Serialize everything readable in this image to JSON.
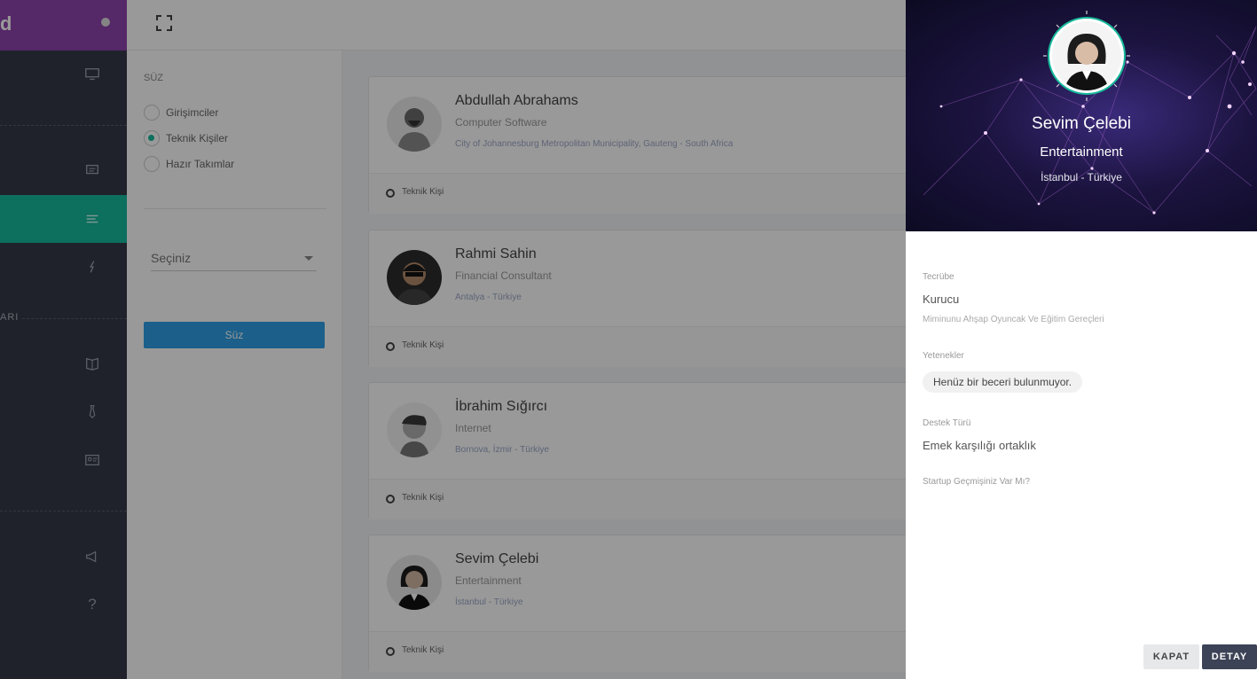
{
  "brand": {
    "logo_text": "d"
  },
  "sidebar": {
    "section_label": "ARI",
    "icons": [
      "monitor-icon",
      "chat-icon",
      "list-icon",
      "rocket-icon",
      "book-icon",
      "tie-icon",
      "id-card-icon",
      "megaphone-icon",
      "help-icon"
    ],
    "help_glyph": "?"
  },
  "filter": {
    "title": "SÜZ",
    "options": [
      {
        "label": "Girişimciler",
        "checked": false
      },
      {
        "label": "Teknik Kişiler",
        "checked": true
      },
      {
        "label": "Hazır Takımlar",
        "checked": false
      }
    ],
    "select_value": "Seçiniz",
    "button_label": "Süz"
  },
  "cards": [
    {
      "name": "Abdullah Abrahams",
      "title": "Computer Software",
      "location": "City of Johannesburg Metropolitan Municipality, Gauteng - South Africa",
      "tag": "Teknik Kişi"
    },
    {
      "name": "Rahmi Sahin",
      "title": "Financial Consultant",
      "location": "Antalya - Türkiye",
      "tag": "Teknik Kişi"
    },
    {
      "name": "İbrahim Sığırcı",
      "title": "Internet",
      "location": "Bornova, İzmir - Türkiye",
      "tag": "Teknik Kişi"
    },
    {
      "name": "Sevim Çelebi",
      "title": "Entertainment",
      "location": "İstanbul - Türkiye",
      "tag": "Teknik Kişi"
    }
  ],
  "profile": {
    "name": "Sevim Çelebi",
    "sector": "Entertainment",
    "location": "İstanbul - Türkiye",
    "experience_label": "Tecrübe",
    "experience_value": "Kurucu",
    "experience_company": "Miminunu Ahşap Oyuncak Ve Eğitim Gereçleri",
    "skills_label": "Yetenekler",
    "skills_empty": "Henüz bir beceri bulunmuyor.",
    "support_label": "Destek Türü",
    "support_value": "Emek karşılığı ortaklık",
    "startup_label": "Startup Geçmişiniz Var Mı?",
    "close_label": "KAPAT",
    "detail_label": "DETAY"
  },
  "colors": {
    "accent_green": "#16b99b",
    "brand_purple": "#8e44ad",
    "sidebar_bg": "#353a48",
    "button_blue": "#2e9fe6",
    "detail_dark": "#3c4356"
  }
}
